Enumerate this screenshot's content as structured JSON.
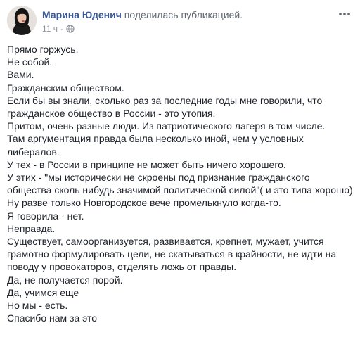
{
  "header": {
    "author_name": "Марина Юденич",
    "action_text": " поделилась публикацией.",
    "timestamp": "11 ч",
    "separator": "·",
    "privacy_icon": "globe-icon",
    "more_icon": "more-horizontal-icon"
  },
  "colors": {
    "author": "#385898",
    "body_text": "#1d2129",
    "meta_text": "#90949c"
  },
  "post": {
    "lines": [
      "Прямо горжусь.",
      "Не собой.",
      "Вами.",
      "Гражданским обществом.",
      "Если бы вы знали, сколько раз за последние годы мне говорили, что",
      "гражданское общество в России - это утопия.",
      "Притом, очень разные люди. Из патриотического лагеря в том числе.",
      "Там аргументация правда была несколько иной, чем у условных",
      "либералов.",
      "У тех - в России в принципе не может быть ничего хорошего.",
      "У этих - \"мы исторически не скроены под признание гражданского",
      "общества сколь нибудь значимой политической силой\"( и это типа хорошо)",
      "Ну разве только Новгородское вече промелькнуло когда-то.",
      "Я говорила - нет.",
      "Неправда.",
      "Существует, самоорганизуется, развивается, крепнет, мужает, учится",
      "грамотно формулировать цели, не скатываться в крайности, не идти на",
      "поводу у провокаторов, отделять ложь от правды.",
      "Да, не получается порой.",
      "Да, учимся еще",
      "Но мы - есть.",
      "Спасибо нам за это"
    ]
  }
}
